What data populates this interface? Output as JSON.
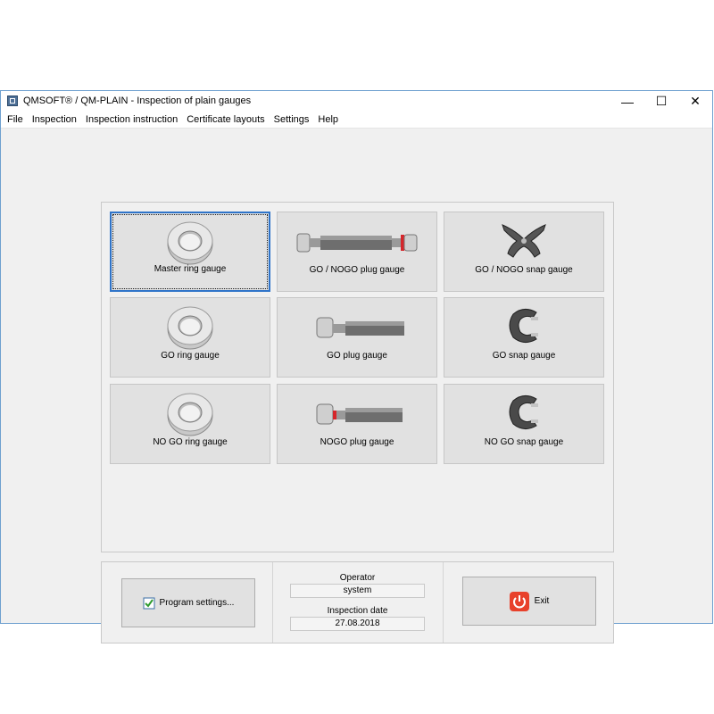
{
  "window": {
    "title": "QMSOFT® / QM-PLAIN - Inspection of plain gauges",
    "controls": {
      "minimize": "—",
      "maximize": "☐",
      "close": "✕"
    }
  },
  "menu": [
    "File",
    "Inspection",
    "Inspection instruction",
    "Certificate layouts",
    "Settings",
    "Help"
  ],
  "tiles": {
    "master_ring": "Master ring gauge",
    "go_nogo_plug": "GO / NOGO plug gauge",
    "go_nogo_snap": "GO / NOGO snap gauge",
    "go_ring": "GO ring gauge",
    "go_plug": "GO plug gauge",
    "go_snap": "GO snap gauge",
    "nogo_ring": "NO GO ring gauge",
    "nogo_plug": "NOGO plug gauge",
    "nogo_snap": "NO GO snap gauge"
  },
  "bottom": {
    "program_settings": "Program settings...",
    "operator_label": "Operator",
    "operator_value": "system",
    "date_label": "Inspection date",
    "date_value": "27.08.2018",
    "exit": "Exit"
  },
  "colors": {
    "selection": "#2f74c9",
    "exit_icon": "#e8412b",
    "accent_red": "#d6262b"
  }
}
